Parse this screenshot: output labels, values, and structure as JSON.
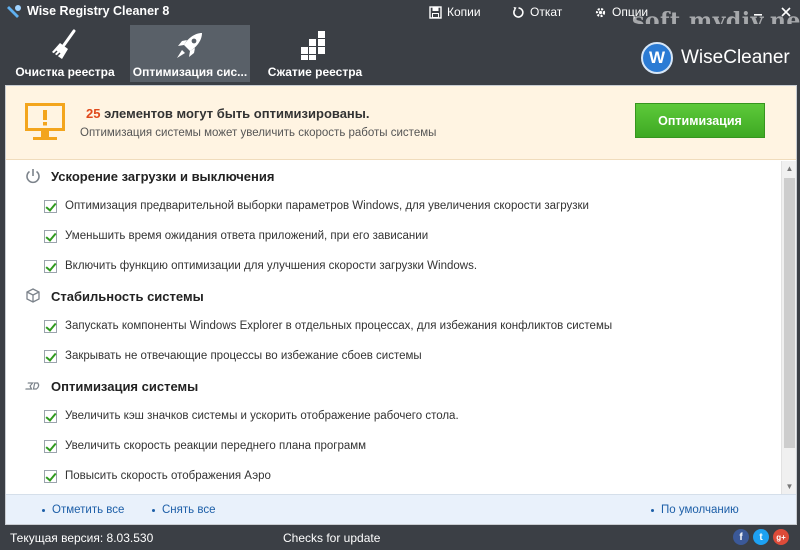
{
  "titlebar": {
    "title": "Wise Registry Cleaner 8",
    "actions": [
      {
        "label": "Копии",
        "icon": "save-icon"
      },
      {
        "label": "Откат",
        "icon": "restore-icon"
      },
      {
        "label": "Опции",
        "icon": "gear-icon"
      }
    ],
    "watermark": "soft.mydiv.net"
  },
  "tabs": [
    {
      "label": "Очистка реестра",
      "icon": "broom-icon",
      "active": false
    },
    {
      "label": "Оптимизация сис...",
      "icon": "rocket-icon",
      "active": true
    },
    {
      "label": "Сжатие реестра",
      "icon": "blocks-icon",
      "active": false
    }
  ],
  "brand": {
    "badge": "W",
    "name": "WiseCleaner"
  },
  "banner": {
    "count": "25",
    "headline_rest": " элементов могут быть оптимизированы.",
    "subtitle": "Оптимизация системы может увеличить скорость работы системы",
    "button": "Оптимизация"
  },
  "sections": [
    {
      "title": "Ускорение загрузки и выключения",
      "icon": "power-icon",
      "items": [
        "Оптимизация предварительной выборки параметров Windows, для увеличения скорости загрузки",
        "Уменьшить время ожидания ответа приложений, при его зависании",
        "Включить функцию оптимизации для улучшения скорости загрузки Windows."
      ]
    },
    {
      "title": "Стабильность системы",
      "icon": "cube-icon",
      "items": [
        "Запускать компоненты Windows Explorer в отдельных процессах, для избежания конфликтов системы",
        "Закрывать не отвечающие процессы во избежание сбоев системы"
      ]
    },
    {
      "title": "Оптимизация системы",
      "icon": "3d-icon",
      "items": [
        "Увеличить кэш значков системы и ускорить отображение рабочего стола.",
        "Увеличить скорость реакции переднего плана программ",
        "Повысить скорость отображения Аэро"
      ]
    }
  ],
  "footer": {
    "check_all": "Отметить все",
    "uncheck_all": "Снять все",
    "default": "По умолчанию"
  },
  "status": {
    "version": "Текущая версия: 8.03.530",
    "update": "Checks for update",
    "social": [
      {
        "glyph": "f",
        "icon": "facebook-icon",
        "color": "#3b5998"
      },
      {
        "glyph": "t",
        "icon": "twitter-icon",
        "color": "#1da1f2"
      },
      {
        "glyph": "g+",
        "icon": "googleplus-icon",
        "color": "#dd4b39"
      }
    ]
  },
  "colors": {
    "accent_green": "#4cb82d",
    "count_red": "#e0491b",
    "link_blue": "#1d5fa8"
  }
}
